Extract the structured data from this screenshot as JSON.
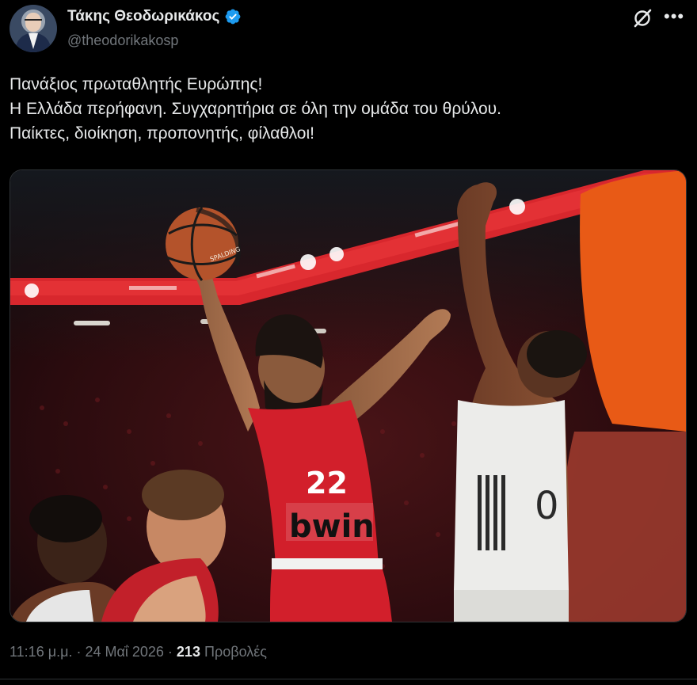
{
  "author": {
    "name": "Τάκης Θεοδωρικάκος",
    "handle": "@theodorikakosp",
    "verified": true
  },
  "icons": {
    "verified": "verified-badge-icon",
    "grok": "grok-icon",
    "more": "more-options-icon"
  },
  "post": {
    "lines": [
      "Πανάξιος πρωταθλητής Ευρώπης!",
      "Η Ελλάδα περήφανη. Συγχαρητήρια σε όλη την ομάδα του θρύλου.",
      "Παίκτες, διοίκηση, προπονητής, φίλαθλοι!"
    ]
  },
  "media": {
    "jersey_number": "22",
    "jersey_sponsor": "bwin",
    "ball_brand": "SPALDING"
  },
  "meta": {
    "time": "11:16 μ.μ.",
    "separator": " · ",
    "date": "24 Μαΐ 2026",
    "views_count": "213",
    "views_label": "Προβολές"
  },
  "colors": {
    "background": "#000000",
    "text": "#e7e9ea",
    "secondary": "#71767b",
    "verified": "#1d9bf0",
    "border": "#2f3336",
    "team_red": "#d21f2b"
  }
}
